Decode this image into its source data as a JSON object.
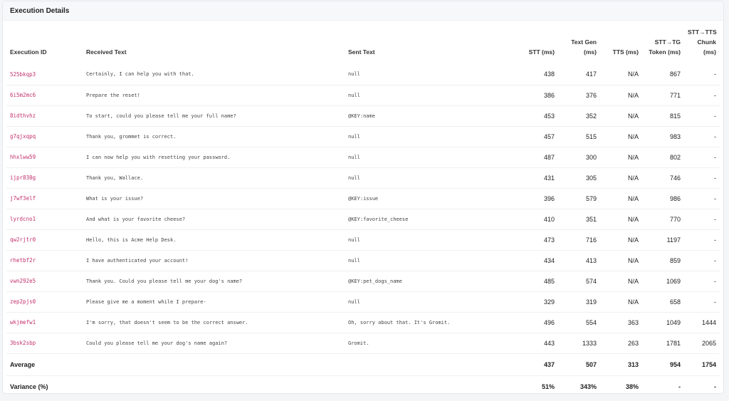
{
  "card": {
    "title": "Execution Details"
  },
  "columns": [
    {
      "key": "id",
      "label": "Execution ID",
      "align": "l"
    },
    {
      "key": "received",
      "label": "Received Text",
      "align": "l"
    },
    {
      "key": "sent",
      "label": "Sent Text",
      "align": "l"
    },
    {
      "key": "stt",
      "label": "STT (ms)",
      "align": "r"
    },
    {
      "key": "textgen",
      "label": "Text Gen (ms)",
      "align": "r"
    },
    {
      "key": "tts",
      "label": "TTS (ms)",
      "align": "r"
    },
    {
      "key": "stt_tg",
      "label": "STT→TG Token (ms)",
      "align": "r"
    },
    {
      "key": "stt_tts",
      "label": "STT→TTS Chunk (ms)",
      "align": "r"
    }
  ],
  "rows": [
    {
      "id": "525bkqp3",
      "received": "Certainly, I can help you with that.",
      "sent": "null",
      "stt": "438",
      "textgen": "417",
      "tts": "N/A",
      "stt_tg": "867",
      "stt_tts": "-"
    },
    {
      "id": "6i5m2mc6",
      "received": "Prepare the reset!",
      "sent": "null",
      "stt": "386",
      "textgen": "376",
      "tts": "N/A",
      "stt_tg": "771",
      "stt_tts": "-"
    },
    {
      "id": "8idthvhz",
      "received": "To start, could you please tell me your full name?",
      "sent": "@KEY:name",
      "stt": "453",
      "textgen": "352",
      "tts": "N/A",
      "stt_tg": "815",
      "stt_tts": "-"
    },
    {
      "id": "g7qjxqpq",
      "received": "Thank you, grommet is correct.",
      "sent": "null",
      "stt": "457",
      "textgen": "515",
      "tts": "N/A",
      "stt_tg": "983",
      "stt_tts": "-"
    },
    {
      "id": "hhxlww59",
      "received": "I can now help you with resetting your password.",
      "sent": "null",
      "stt": "487",
      "textgen": "300",
      "tts": "N/A",
      "stt_tg": "802",
      "stt_tts": "-"
    },
    {
      "id": "ijpr830g",
      "received": "Thank you, Wallace.",
      "sent": "null",
      "stt": "431",
      "textgen": "305",
      "tts": "N/A",
      "stt_tg": "746",
      "stt_tts": "-"
    },
    {
      "id": "j7wf3elf",
      "received": "What is your issue?",
      "sent": "@KEY:issue",
      "stt": "396",
      "textgen": "579",
      "tts": "N/A",
      "stt_tg": "986",
      "stt_tts": "-"
    },
    {
      "id": "lyrdcno1",
      "received": "And what is your favorite cheese?",
      "sent": "@KEY:favorite_cheese",
      "stt": "410",
      "textgen": "351",
      "tts": "N/A",
      "stt_tg": "770",
      "stt_tts": "-"
    },
    {
      "id": "qw2rjtr0",
      "received": "Hello, this is Acme Help Desk.",
      "sent": "null",
      "stt": "473",
      "textgen": "716",
      "tts": "N/A",
      "stt_tg": "1197",
      "stt_tts": "-"
    },
    {
      "id": "rhetbf2r",
      "received": "I have authenticated your account!",
      "sent": "null",
      "stt": "434",
      "textgen": "413",
      "tts": "N/A",
      "stt_tg": "859",
      "stt_tts": "-"
    },
    {
      "id": "vwn292e5",
      "received": "Thank you. Could you please tell me your dog's name?",
      "sent": "@KEY:pet_dogs_name",
      "stt": "485",
      "textgen": "574",
      "tts": "N/A",
      "stt_tg": "1069",
      "stt_tts": "-"
    },
    {
      "id": "zep2pjs0",
      "received": "Please give me a moment while I prepare-",
      "sent": "null",
      "stt": "329",
      "textgen": "319",
      "tts": "N/A",
      "stt_tg": "658",
      "stt_tts": "-"
    },
    {
      "id": "wkjmefw1",
      "received": "I'm sorry, that doesn't seem to be the correct answer.",
      "sent": "Oh, sorry about that. It's Gromit.",
      "stt": "496",
      "textgen": "554",
      "tts": "363",
      "stt_tg": "1049",
      "stt_tts": "1444"
    },
    {
      "id": "3bsk2sbp",
      "received": "Could you please tell me your dog's name again?",
      "sent": "Gromit.",
      "stt": "443",
      "textgen": "1333",
      "tts": "263",
      "stt_tg": "1781",
      "stt_tts": "2065"
    }
  ],
  "summary": {
    "average": {
      "label": "Average",
      "stt": "437",
      "textgen": "507",
      "tts": "313",
      "stt_tg": "954",
      "stt_tts": "1754"
    },
    "variance": {
      "label": "Variance (%)",
      "stt": "51%",
      "textgen": "343%",
      "tts": "38%",
      "stt_tg": "-",
      "stt_tts": "-"
    }
  }
}
